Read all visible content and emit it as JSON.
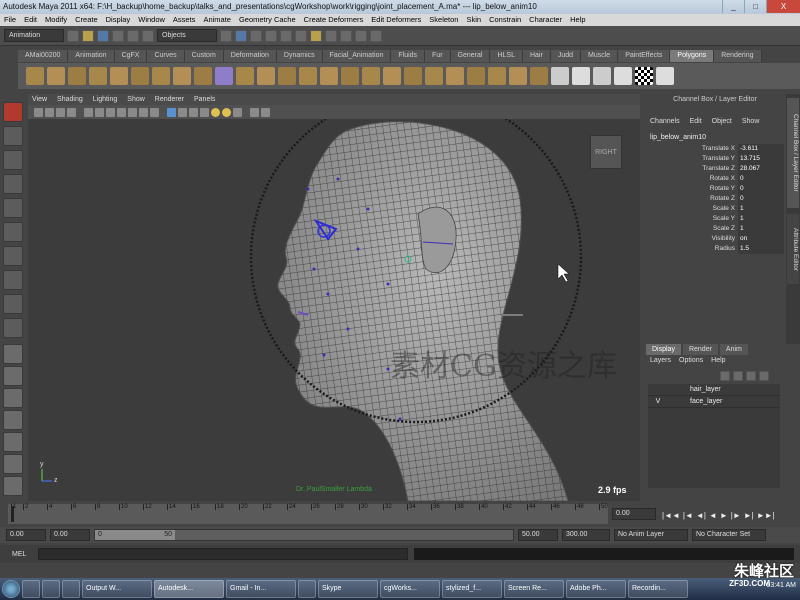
{
  "window": {
    "title": "Autodesk Maya 2011 x64: F:\\H_backup\\home_backup\\talks_and_presentations\\cgWorkshop\\work\\rigging\\joint_placement_A.ma*    ---    lip_below_anim10",
    "buttons": [
      "_",
      "□",
      "X"
    ]
  },
  "menubar": [
    "File",
    "Edit",
    "Modify",
    "Create",
    "Display",
    "Window",
    "Assets",
    "Animate",
    "Geometry Cache",
    "Create Deformers",
    "Edit Deformers",
    "Skeleton",
    "Skin",
    "Constrain",
    "Character",
    "Help"
  ],
  "statusline": {
    "mode": "Animation",
    "objects_field": "Objects"
  },
  "shelf": {
    "tabs": [
      "AMai00200",
      "Animation",
      "CgFX",
      "Curves",
      "Custom",
      "Deformation",
      "Dynamics",
      "Facial_Animation",
      "Fluids",
      "Fur",
      "General",
      "HLSL",
      "Hair",
      "Judd",
      "Muscle",
      "PaintEffects",
      "Polygons",
      "Rendering"
    ],
    "active_tab": "Polygons"
  },
  "panel": {
    "menu": [
      "View",
      "Shading",
      "Lighting",
      "Show",
      "Renderer",
      "Panels"
    ],
    "view_cube": "RIGHT",
    "fps": "2.9 fps",
    "hud_label": "Dr. PaulSmaller Lambda",
    "watermark": "素材CG资源之库"
  },
  "channelbox": {
    "header": "Channel Box / Layer Editor",
    "menu": [
      "Channels",
      "Edit",
      "Object",
      "Show"
    ],
    "object": "lip_below_anim10",
    "attrs": [
      {
        "label": "Translate X",
        "value": "-3.611"
      },
      {
        "label": "Translate Y",
        "value": "13.715"
      },
      {
        "label": "Translate Z",
        "value": "28.067"
      },
      {
        "label": "Rotate X",
        "value": "0"
      },
      {
        "label": "Rotate Y",
        "value": "0"
      },
      {
        "label": "Rotate Z",
        "value": "0"
      },
      {
        "label": "Scale X",
        "value": "1"
      },
      {
        "label": "Scale Y",
        "value": "1"
      },
      {
        "label": "Scale Z",
        "value": "1"
      },
      {
        "label": "Visibility",
        "value": "on"
      },
      {
        "label": "Radius",
        "value": "1.5"
      }
    ],
    "side_tabs": [
      "Channel Box / Layer Editor",
      "Attribute Editor"
    ]
  },
  "layer_editor": {
    "tabs": [
      "Display",
      "Render",
      "Anim"
    ],
    "active_tab": "Display",
    "menu": [
      "Layers",
      "Options",
      "Help"
    ],
    "layers": [
      {
        "visible": "",
        "name": "hair_layer"
      },
      {
        "visible": "V",
        "name": "face_layer"
      }
    ]
  },
  "timeslider": {
    "ticks": [
      "1",
      "2",
      "4",
      "6",
      "8",
      "10",
      "12",
      "14",
      "16",
      "18",
      "20",
      "22",
      "24",
      "26",
      "28",
      "30",
      "32",
      "34",
      "36",
      "38",
      "40",
      "42",
      "44",
      "46",
      "48",
      "50"
    ],
    "current_frame": "0.00"
  },
  "rangeslider": {
    "start": "0.00",
    "playback_start": "0.00",
    "range_label_start": "0",
    "range_label_end": "50",
    "playback_end": "50.00",
    "end": "300.00",
    "anim_layer": "No Anim Layer",
    "character_set": "No Character Set"
  },
  "commandline": {
    "label": "MEL"
  },
  "taskbar": {
    "items": [
      "Output W...",
      "Autodesk...",
      "Gmail - In...",
      "",
      "Skype",
      "cgWorks...",
      "stylized_f...",
      "Screen Re...",
      "Adobe Ph...",
      "Recordin..."
    ],
    "clock": "03:41 AM",
    "watermark": "朱峰社区",
    "watermark_url": "ZF3D.COM"
  }
}
